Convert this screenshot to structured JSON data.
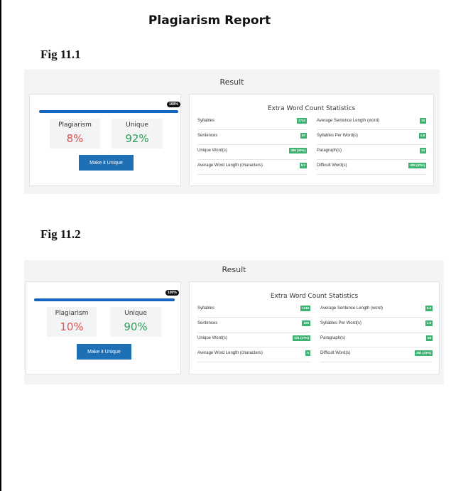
{
  "document": {
    "title": "Plagiarism Report",
    "figures": [
      {
        "label": "Fig 11.1",
        "result_title": "Result",
        "progress_label": "100%",
        "plagiarism_label": "Plagiarism",
        "plagiarism_value": "8%",
        "unique_label": "Unique",
        "unique_value": "92%",
        "button_label": "Make it Unique",
        "stats_title": "Extra Word Count Statistics",
        "left_stats": [
          {
            "label": "Syllables",
            "value": "1742"
          },
          {
            "label": "Sentences",
            "value": "87"
          },
          {
            "label": "Unique Word(s)",
            "value": "386 (40%)"
          },
          {
            "label": "Average Word Length (characters)",
            "value": "5.1"
          }
        ],
        "right_stats": [
          {
            "label": "Average Sentence Length (word)",
            "value": "10"
          },
          {
            "label": "Syllables Per Word(s)",
            "value": "1.8"
          },
          {
            "label": "Paragraph(s)",
            "value": "34"
          },
          {
            "label": "Difficult Word(s)",
            "value": "409 (42%)"
          }
        ]
      },
      {
        "label": "Fig 11.2",
        "result_title": "Result",
        "progress_label": "100%",
        "plagiarism_label": "Plagiarism",
        "plagiarism_value": "10%",
        "unique_label": "Unique",
        "unique_value": "90%",
        "button_label": "Make it Unique",
        "stats_title": "Extra Word Count Statistics",
        "left_stats": [
          {
            "label": "Syllables",
            "value": "1134"
          },
          {
            "label": "Sentences",
            "value": "109"
          },
          {
            "label": "Unique Word(s)",
            "value": "221 (37%)"
          },
          {
            "label": "Average Word Length (characters)",
            "value": "5"
          }
        ],
        "right_stats": [
          {
            "label": "Average Sentence Length (word)",
            "value": "5.6"
          },
          {
            "label": "Syllables Per Word(s)",
            "value": "1.9"
          },
          {
            "label": "Paragraph(s)",
            "value": "58"
          },
          {
            "label": "Difficult Word(s)",
            "value": "251 (41%)"
          }
        ]
      }
    ]
  },
  "colors": {
    "plagiarism": "#d9534f",
    "unique": "#2e9e55",
    "button": "#1f6fb5",
    "badge": "#3cb371",
    "progress": "#1565c0"
  }
}
